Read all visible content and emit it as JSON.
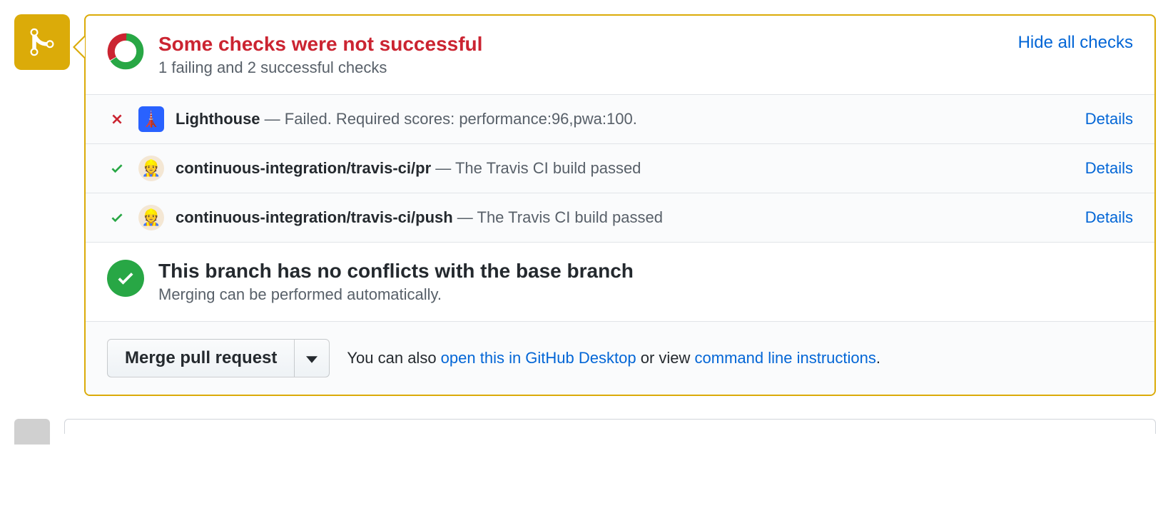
{
  "timeline_icon": "merge-icon",
  "header": {
    "title": "Some checks were not successful",
    "subtitle": "1 failing and 2 successful checks",
    "hide_label": "Hide all checks",
    "donut": {
      "pass_fraction": 0.67,
      "fail_fraction": 0.33
    }
  },
  "checks": [
    {
      "status": "fail",
      "app_icon": "lighthouse",
      "name": "Lighthouse",
      "desc": "— Failed. Required scores: performance:96,pwa:100.",
      "action": "Details"
    },
    {
      "status": "pass",
      "app_icon": "travis",
      "name": "continuous-integration/travis-ci/pr",
      "desc": "— The Travis CI build passed",
      "action": "Details"
    },
    {
      "status": "pass",
      "app_icon": "travis",
      "name": "continuous-integration/travis-ci/push",
      "desc": "— The Travis CI build passed",
      "action": "Details"
    }
  ],
  "conflict": {
    "title": "This branch has no conflicts with the base branch",
    "subtitle": "Merging can be performed automatically."
  },
  "merge": {
    "button": "Merge pull request",
    "help_prefix": "You can also ",
    "desktop_link": "open this in GitHub Desktop",
    "help_mid": " or view ",
    "cli_link": "command line instructions",
    "help_suffix": "."
  }
}
